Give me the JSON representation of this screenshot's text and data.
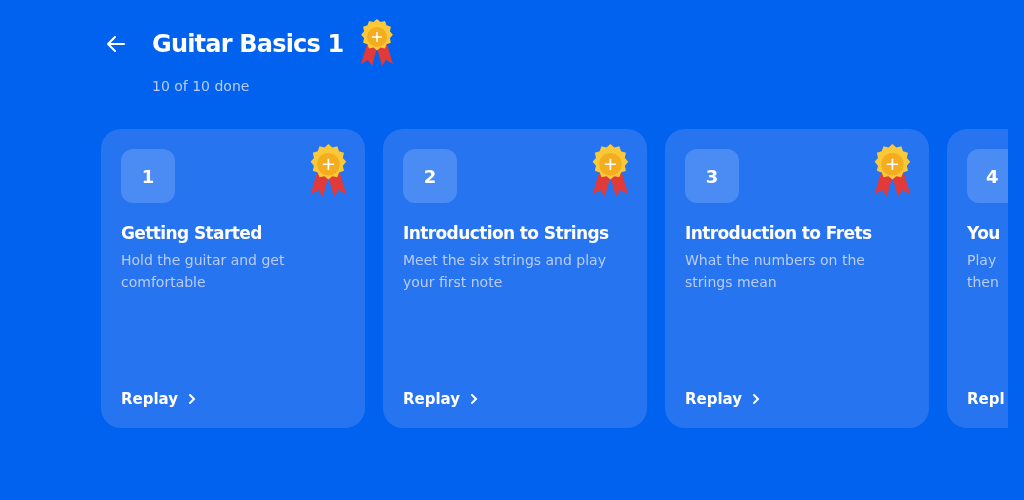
{
  "header": {
    "title": "Guitar Basics 1",
    "completed": true,
    "progress": "10 of 10 done"
  },
  "lessons": [
    {
      "number": "1",
      "title": "Getting Started",
      "description": "Hold the guitar and get comfortable",
      "action": "Replay",
      "completed": true
    },
    {
      "number": "2",
      "title": "Introduction to Strings",
      "description": "Meet the six strings and play your first note",
      "action": "Replay",
      "completed": true
    },
    {
      "number": "3",
      "title": "Introduction to Frets",
      "description": "What the numbers on the strings mean",
      "action": "Replay",
      "completed": true
    },
    {
      "number": "4",
      "title": "You",
      "description": "Play\nthen",
      "action": "Repl"
    }
  ]
}
